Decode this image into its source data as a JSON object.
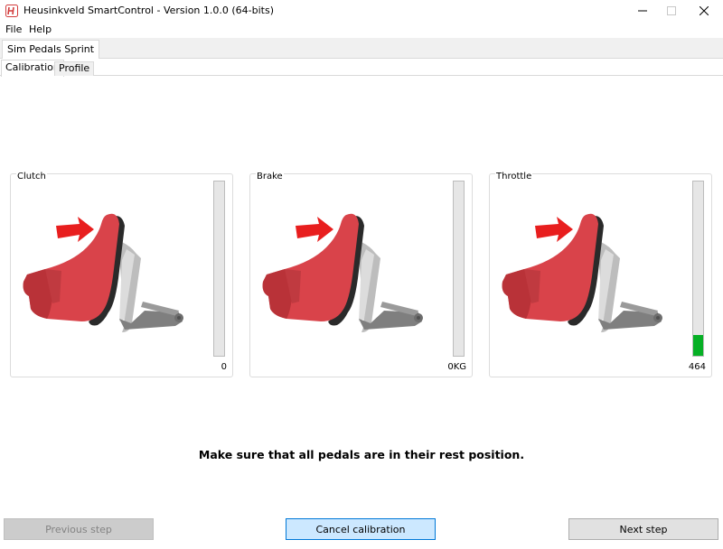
{
  "window": {
    "title": "Heusinkveld SmartControl - Version 1.0.0 (64-bits)",
    "icon": "heusinkveld-logo-icon",
    "controls": [
      "minimize-icon",
      "maximize-icon",
      "close-icon"
    ]
  },
  "menu": {
    "items": [
      "File",
      "Help"
    ]
  },
  "device_tabs": [
    {
      "label": "Sim Pedals Sprint",
      "active": true
    }
  ],
  "tabs": [
    {
      "label": "Calibration",
      "active": true
    },
    {
      "label": "Profile",
      "active": false
    }
  ],
  "pedals": [
    {
      "name": "Clutch",
      "value_label": "0",
      "level": 0.0,
      "illustration": "foot-pressing-pedal-icon"
    },
    {
      "name": "Brake",
      "value_label": "0KG",
      "level": 0.0,
      "illustration": "foot-pressing-pedal-icon"
    },
    {
      "name": "Throttle",
      "value_label": "464",
      "level": 0.12,
      "illustration": "foot-pressing-pedal-icon"
    }
  ],
  "colors": {
    "accent": "#0078d7",
    "bar_fill": "#06b025",
    "foot": "#d9434a",
    "arrow": "#e81e1e"
  },
  "instruction": "Make sure that all pedals are in their rest position.",
  "buttons": {
    "previous": {
      "label": "Previous step",
      "enabled": false
    },
    "cancel": {
      "label": "Cancel calibration",
      "enabled": true
    },
    "next": {
      "label": "Next step",
      "enabled": true
    }
  }
}
